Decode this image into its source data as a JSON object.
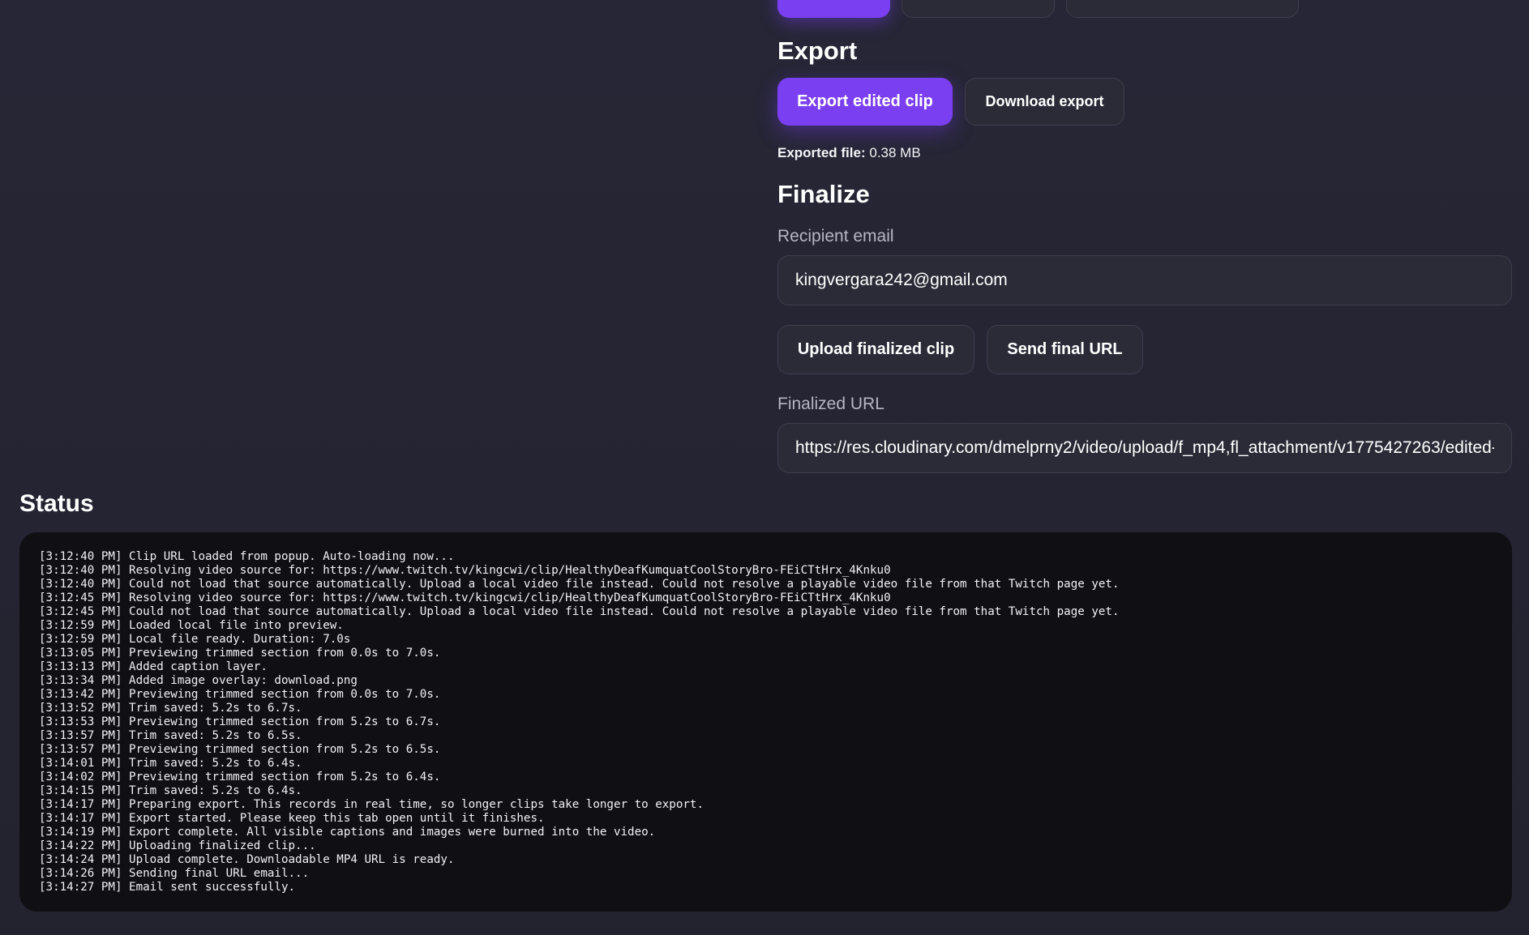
{
  "export": {
    "heading": "Export",
    "export_button": "Export edited clip",
    "download_button": "Download export",
    "exported_label": "Exported file:",
    "exported_value": "0.38 MB"
  },
  "finalize": {
    "heading": "Finalize",
    "email_label": "Recipient email",
    "email_value": "kingvergara242@gmail.com",
    "upload_button": "Upload finalized clip",
    "send_button": "Send final URL",
    "url_label": "Finalized URL",
    "url_value": "https://res.cloudinary.com/dmelprny2/video/upload/f_mp4,fl_attachment/v1775427263/edited-"
  },
  "status": {
    "heading": "Status",
    "lines": [
      "[3:12:40 PM] Clip URL loaded from popup. Auto-loading now...",
      "[3:12:40 PM] Resolving video source for: https://www.twitch.tv/kingcwi/clip/HealthyDeafKumquatCoolStoryBro-FEiCTtHrx_4Knku0",
      "[3:12:40 PM] Could not load that source automatically. Upload a local video file instead. Could not resolve a playable video file from that Twitch page yet.",
      "[3:12:45 PM] Resolving video source for: https://www.twitch.tv/kingcwi/clip/HealthyDeafKumquatCoolStoryBro-FEiCTtHrx_4Knku0",
      "[3:12:45 PM] Could not load that source automatically. Upload a local video file instead. Could not resolve a playable video file from that Twitch page yet.",
      "[3:12:59 PM] Loaded local file into preview.",
      "[3:12:59 PM] Local file ready. Duration: 7.0s",
      "[3:13:05 PM] Previewing trimmed section from 0.0s to 7.0s.",
      "[3:13:13 PM] Added caption layer.",
      "[3:13:34 PM] Added image overlay: download.png",
      "[3:13:42 PM] Previewing trimmed section from 0.0s to 7.0s.",
      "[3:13:52 PM] Trim saved: 5.2s to 6.7s.",
      "[3:13:53 PM] Previewing trimmed section from 5.2s to 6.7s.",
      "[3:13:57 PM] Trim saved: 5.2s to 6.5s.",
      "[3:13:57 PM] Previewing trimmed section from 5.2s to 6.5s.",
      "[3:14:01 PM] Trim saved: 5.2s to 6.4s.",
      "[3:14:02 PM] Previewing trimmed section from 5.2s to 6.4s.",
      "[3:14:15 PM] Trim saved: 5.2s to 6.4s.",
      "[3:14:17 PM] Preparing export. This records in real time, so longer clips take longer to export.",
      "[3:14:17 PM] Export started. Please keep this tab open until it finishes.",
      "[3:14:19 PM] Export complete. All visible captions and images were burned into the video.",
      "[3:14:22 PM] Uploading finalized clip...",
      "[3:14:24 PM] Upload complete. Downloadable MP4 URL is ready.",
      "[3:14:26 PM] Sending final URL email...",
      "[3:14:27 PM] Email sent successfully."
    ]
  }
}
